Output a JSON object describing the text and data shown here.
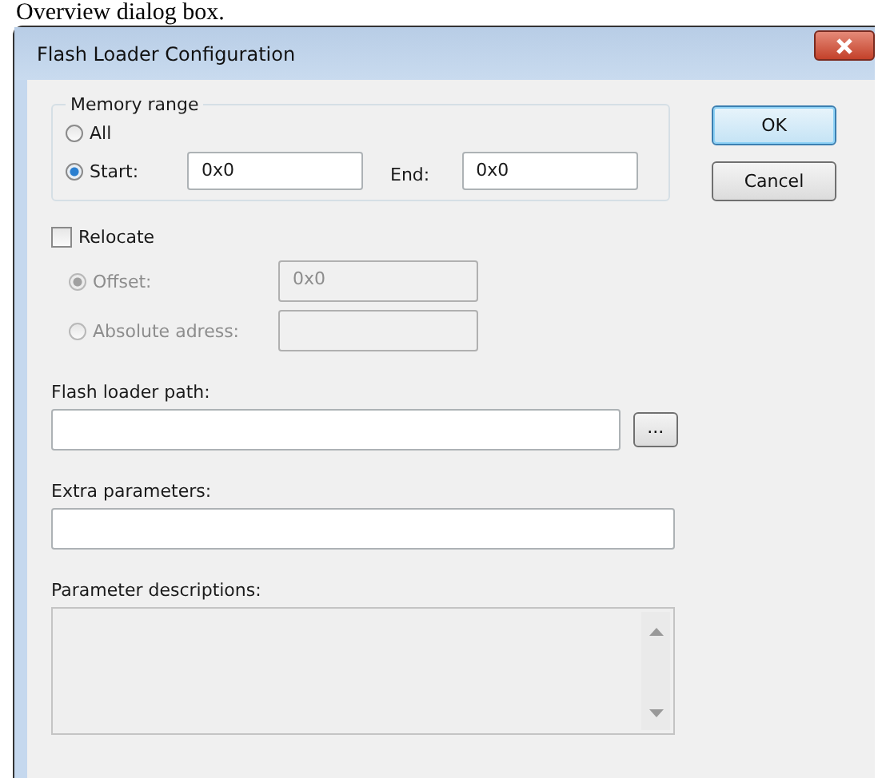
{
  "caption": "Overview dialog box.",
  "window": {
    "title": "Flash Loader Configuration"
  },
  "memory_range": {
    "label": "Memory range",
    "options": [
      {
        "label": "All",
        "selected": false
      },
      {
        "label": "Start:",
        "selected": true
      }
    ],
    "start": "0x0",
    "end_label": "End:",
    "end": "0x0"
  },
  "relocate": {
    "label": "Relocate",
    "checked": false,
    "options": [
      {
        "label": "Offset:",
        "selected": true,
        "value": "0x0"
      },
      {
        "label": "Absolute adress:",
        "selected": false
      }
    ]
  },
  "flash_loader_path": {
    "label": "Flash loader path:",
    "browse": "..."
  },
  "extra_parameters": {
    "label": "Extra parameters:"
  },
  "parameter_descriptions": {
    "label": "Parameter descriptions:"
  },
  "buttons": [
    "OK",
    "Cancel"
  ]
}
